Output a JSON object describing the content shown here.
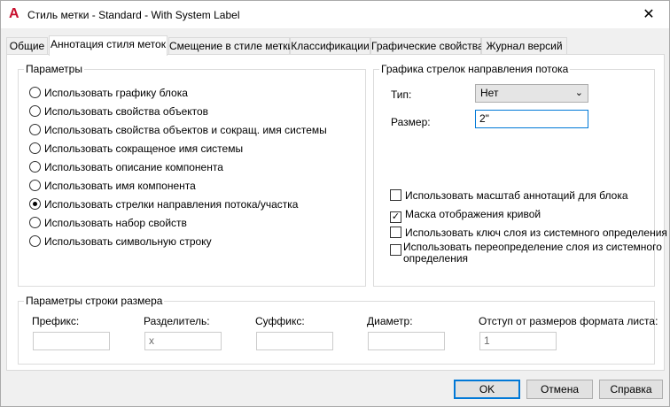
{
  "window": {
    "title": "Стиль метки - Standard - With System Label",
    "app_icon_glyph": "A",
    "close_glyph": "✕"
  },
  "tabs": [
    {
      "label": "Общие"
    },
    {
      "label": "Аннотация стиля меток"
    },
    {
      "label": "Смещение в стиле метки"
    },
    {
      "label": "Классификации"
    },
    {
      "label": "Графические свойства"
    },
    {
      "label": "Журнал версий"
    }
  ],
  "active_tab": "Аннотация стиля меток",
  "params": {
    "title": "Параметры",
    "options": [
      {
        "label": "Использовать графику блока",
        "selected": false
      },
      {
        "label": "Использовать свойства объектов",
        "selected": false
      },
      {
        "label": "Использовать свойства объектов и сокращ. имя системы",
        "selected": false
      },
      {
        "label": "Использовать сокращеное имя системы",
        "selected": false
      },
      {
        "label": "Использовать описание компонента",
        "selected": false
      },
      {
        "label": "Использовать имя компонента",
        "selected": false
      },
      {
        "label": "Использовать стрелки направления потока/участка",
        "selected": true
      },
      {
        "label": "Использовать набор свойств",
        "selected": false
      },
      {
        "label": "Использовать символьную строку",
        "selected": false
      }
    ]
  },
  "arrows": {
    "title": "Графика стрелок направления потока",
    "type_label": "Тип:",
    "type_value": "Нет",
    "size_label": "Размер:",
    "size_value": "2\"",
    "checkboxes": [
      {
        "label": "Использовать масштаб аннотаций для блока",
        "checked": false
      },
      {
        "label": "Маска отображения кривой",
        "checked": true
      },
      {
        "label": "Использовать ключ слоя из системного определения",
        "checked": false
      },
      {
        "label": "Использовать переопределение слоя из системного определения",
        "checked": false
      }
    ],
    "checkbox_4_line1": "Использовать переопределение слоя из системного",
    "checkbox_4_line2": "определения"
  },
  "size_params": {
    "title": "Параметры строки размера",
    "prefix_label": "Префикс:",
    "prefix_value": "",
    "separator_label": "Разделитель:",
    "separator_value": "x",
    "suffix_label": "Суффикс:",
    "suffix_value": "",
    "diameter_label": "Диаметр:",
    "diameter_value": "",
    "offset_label": "Отступ от размеров формата листа:",
    "offset_value": "1"
  },
  "buttons": {
    "ok": "OK",
    "cancel": "Отмена",
    "help": "Справка"
  },
  "colors": {
    "accent": "#0078d7",
    "app_icon": "#c8102e"
  }
}
